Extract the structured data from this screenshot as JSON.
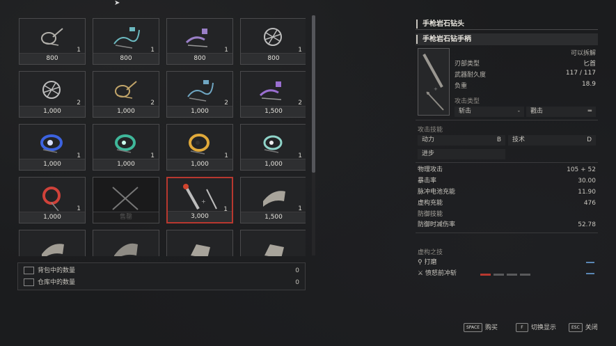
{
  "shop_items": [
    {
      "qty": "1",
      "price": "800",
      "icon": "wheel-handle-icon",
      "color": "#b2b0ab"
    },
    {
      "qty": "1",
      "price": "800",
      "icon": "spring-handle-icon",
      "color": "#6bb8bf"
    },
    {
      "qty": "1",
      "price": "800",
      "icon": "purple-crank-icon",
      "color": "#9a7fc7"
    },
    {
      "qty": "1",
      "price": "800",
      "icon": "fan-wheel-icon",
      "color": "#bdbdbd"
    },
    {
      "qty": "2",
      "price": "1,000",
      "icon": "fan-wheel-icon",
      "color": "#bdbdbd"
    },
    {
      "qty": "2",
      "price": "1,000",
      "icon": "wheel-handle-icon",
      "color": "#c2a56a"
    },
    {
      "qty": "2",
      "price": "1,000",
      "icon": "spring-handle-icon",
      "color": "#6fa6c2"
    },
    {
      "qty": "2",
      "price": "1,500",
      "icon": "purple-crank-icon",
      "color": "#9a6fd0"
    },
    {
      "qty": "1",
      "price": "1,000",
      "icon": "blue-gear-icon",
      "color": "#3c63e0"
    },
    {
      "qty": "1",
      "price": "1,000",
      "icon": "green-gear-icon",
      "color": "#3fb79a"
    },
    {
      "qty": "1",
      "price": "1,000",
      "icon": "gold-gear-icon",
      "color": "#e0a93a"
    },
    {
      "qty": "1",
      "price": "1,000",
      "icon": "teal-gear-icon",
      "color": "#8fd4c9"
    },
    {
      "qty": "1",
      "price": "1,000",
      "icon": "red-gear-icon",
      "color": "#d0423a"
    },
    {
      "qty": "",
      "price": "售罄",
      "icon": "crossed-blades-icon",
      "color": "#777777",
      "sold": true
    },
    {
      "qty": "1",
      "price": "3,000",
      "icon": "drill-weapon-icon",
      "color": "#bdbdbd",
      "selected": true
    },
    {
      "qty": "1",
      "price": "1,500",
      "icon": "cloth-icon",
      "color": "#a8a49b"
    },
    {
      "qty": "",
      "price": "",
      "icon": "cloth-icon",
      "color": "#a19d94"
    },
    {
      "qty": "",
      "price": "",
      "icon": "mesh-cloth-icon",
      "color": "#9a978f"
    },
    {
      "qty": "",
      "price": "",
      "icon": "armor-piece-icon",
      "color": "#a8a49b"
    },
    {
      "qty": "",
      "price": "",
      "icon": "armor-piece-icon",
      "color": "#a8a49b"
    }
  ],
  "counts": {
    "bag_label": "背包中的数量",
    "bag_value": "0",
    "storage_label": "仓库中的数量",
    "storage_value": "0"
  },
  "detail": {
    "title_head": "手枪岩石钻头",
    "title_handle": "手枪岩石钻手柄",
    "detachable": "可以拆解",
    "blade_type_label": "刃部类型",
    "blade_type_value": "匕首",
    "durability_label": "武器耐久度",
    "durability_value": "117 / 117",
    "weight_label": "负重",
    "weight_value": "18.9",
    "attack_type_label": "攻击类型",
    "attack_type_1": "斩击",
    "attack_type_1_v": "-",
    "attack_type_2": "戳击",
    "attack_type_2_v": "═",
    "attack_skill_label": "攻击技能",
    "skill_1": "动力",
    "skill_1_v": "B",
    "skill_2": "技术",
    "skill_2_v": "D",
    "skill_3": "进步",
    "stats": [
      {
        "label": "物理攻击",
        "value": "105 + 52"
      },
      {
        "label": "暴击率",
        "value": "30.00"
      },
      {
        "label": "脉冲电池充能",
        "value": "11.90"
      },
      {
        "label": "虚构充能",
        "value": "476"
      }
    ],
    "guard_skill_label": "防御技能",
    "guard_stat": {
      "label": "防御时减伤率",
      "value": "52.78"
    },
    "fable_label": "虚构之技",
    "fable_arts": [
      "打磨",
      "愤怒前冲斩"
    ]
  },
  "footer": {
    "buy_key": "SPACE",
    "buy_label": "购买",
    "toggle_key": "F",
    "toggle_label": "切换显示",
    "close_key": "ESC",
    "close_label": "关闭"
  }
}
